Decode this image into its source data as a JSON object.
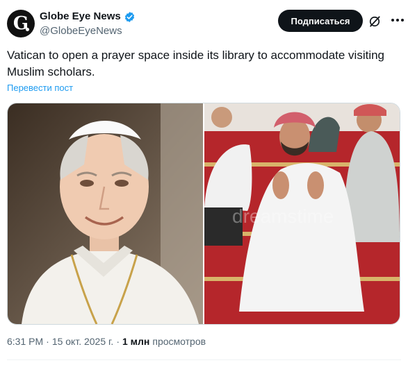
{
  "account": {
    "display_name": "Globe Eye News",
    "handle": "@GlobeEyeNews",
    "avatar_letter": "G",
    "verified_color": "#1d9bf0"
  },
  "actions": {
    "subscribe_label": "Подписаться",
    "grok_icon": "grok-icon",
    "more_icon": "more-icon"
  },
  "post": {
    "text": "Vatican to open a prayer space inside its library to accommodate visiting Muslim scholars.",
    "translate_label": "Перевести пост"
  },
  "media": [
    {
      "icon": "portrait-photo"
    },
    {
      "icon": "prayer-photo"
    }
  ],
  "meta": {
    "time": "6:31 PM",
    "sep1": "·",
    "date": "15 окт. 2025 г.",
    "sep2": "·",
    "views_count": "1 млн",
    "views_label": "просмотров"
  }
}
